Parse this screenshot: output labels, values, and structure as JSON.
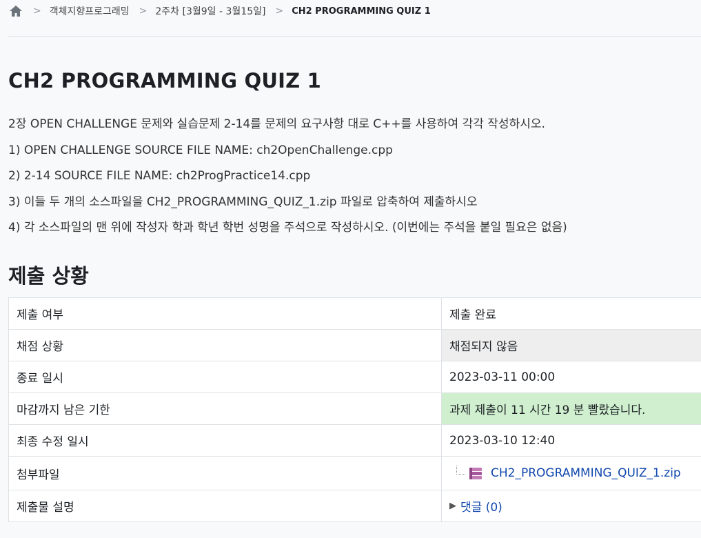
{
  "breadcrumb": {
    "home_icon": "home-icon",
    "items": [
      "객체지향프로그래밍",
      "2주차 [3월9일 - 3월15일]"
    ],
    "current": "CH2 PROGRAMMING QUIZ 1",
    "separator": ">"
  },
  "page": {
    "title": "CH2 PROGRAMMING QUIZ 1",
    "intro": [
      "2장 OPEN CHALLENGE 문제와 실습문제 2-14를 문제의 요구사항 대로 C++를 사용하여 각각 작성하시오.",
      "1) OPEN CHALLENGE  SOURCE FILE NAME: ch2OpenChallenge.cpp",
      "2) 2-14  SOURCE FILE NAME: ch2ProgPractice14.cpp",
      "3) 이들 두 개의 소스파일을 CH2_PROGRAMMING_QUIZ_1.zip 파일로 압축하여 제출하시오",
      "4) 각 소스파일의 맨 위에 작성자 학과 학년 학번 성명을 주석으로  작성하시오. (이번에는 주석을 붙일 필요은 없음)"
    ]
  },
  "submission": {
    "title": "제출 상황",
    "rows": [
      {
        "label": "제출 여부",
        "value": "제출 완료"
      },
      {
        "label": "채점 상황",
        "value": "채점되지 않음"
      },
      {
        "label": "종료 일시",
        "value": "2023-03-11 00:00"
      },
      {
        "label": "마감까지 남은 기한",
        "value": "과제 제출이 11 시간 19 분 빨랐습니다."
      },
      {
        "label": "최종 수정 일시",
        "value": "2023-03-10 12:40"
      },
      {
        "label": "첨부파일",
        "value": "CH2_PROGRAMMING_QUIZ_1.zip",
        "icon": "zip-archive-icon"
      },
      {
        "label": "제출물 설명",
        "value": "댓글 (0)",
        "icon": "triangle-right-icon"
      }
    ]
  },
  "colors": {
    "submitted_text": "#357a32",
    "grading_bg": "#eeeeee",
    "early_bg": "#cfefcf",
    "link": "#0f47ad"
  }
}
